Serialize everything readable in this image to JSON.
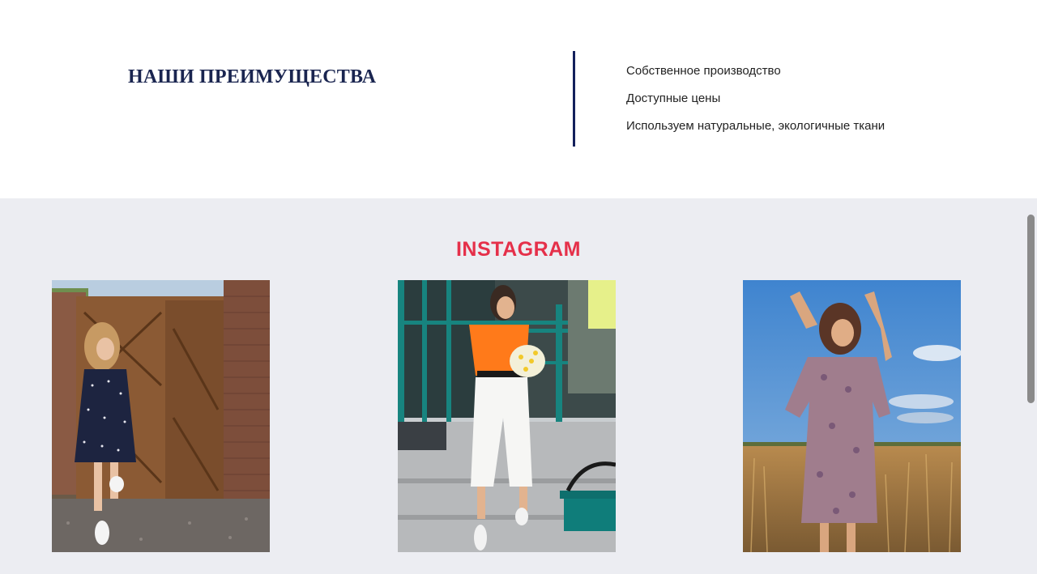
{
  "advantages": {
    "title": "НАШИ ПРЕИМУЩЕСТВА",
    "items": [
      "Собственное производство",
      "Доступные цены",
      "Используем натуральные, экологичные ткани"
    ],
    "divider_color": "#13205c",
    "title_color": "#1a2550"
  },
  "instagram": {
    "title": "INSTAGRAM",
    "title_color": "#e5304a",
    "background": "#ecedf2",
    "photos": [
      {
        "subject": "woman in navy polka-dot dress by wooden gate"
      },
      {
        "subject": "woman in orange top with daisy bouquet on steps"
      },
      {
        "subject": "woman in floral dress in golden field"
      }
    ]
  }
}
